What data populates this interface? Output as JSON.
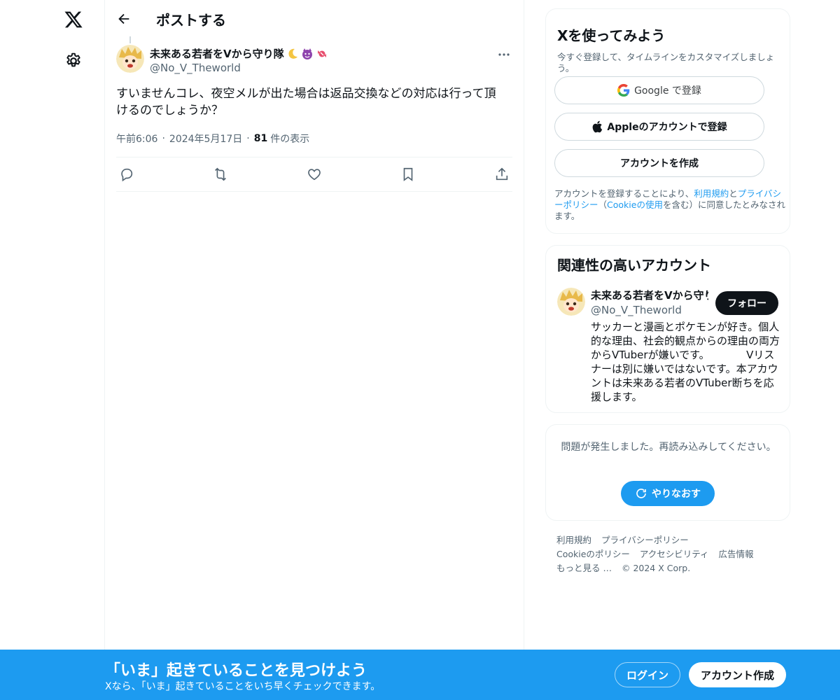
{
  "header": {
    "title": "ポストする"
  },
  "post": {
    "author_name": "未来ある若者をVから守り隊",
    "author_handle": "@No_V_Theworld",
    "text": "すいませんコレ、夜空メルが出た場合は返品交換などの対応は行って頂けるのでしょうか？",
    "time": "午前6:06",
    "date": "2024年5月17日",
    "views_count": "81",
    "views_label": "件の表示"
  },
  "signup_card": {
    "title": "Xを使ってみよう",
    "subtitle": "今すぐ登録して、タイムラインをカスタマイズしましょう。",
    "google_label": "Google で登録",
    "apple_label": "Appleのアカウントで登録",
    "create_label": "アカウントを作成",
    "legal_prefix": "アカウントを登録することにより、",
    "legal_terms": "利用規約",
    "legal_and": "と",
    "legal_privacy": "プライバシーポリシー",
    "legal_open": "（",
    "legal_cookie": "Cookieの使用",
    "legal_suffix": "を含む）に同意したとみなされます。"
  },
  "related_card": {
    "title": "関連性の高いアカウント",
    "name": "未来ある若者をVから守り隊",
    "handle": "@No_V_Theworld",
    "follow_label": "フォロー",
    "bio": "サッカーと漫画とポケモンが好き。個人的な理由、社会的観点からの理由の両方からVTuberが嫌いです。　　　　Vリスナーは別に嫌いではないです。本アカウントは未来ある若者のVTuber断ちを応援します。"
  },
  "error_card": {
    "message": "問題が発生しました。再読み込みしてください。",
    "retry_label": "やりなおす"
  },
  "footer": {
    "terms": "利用規約",
    "privacy": "プライバシーポリシー",
    "cookie": "Cookieのポリシー",
    "accessibility": "アクセシビリティ",
    "ads": "広告情報",
    "more": "もっと見る …",
    "copyright": "© 2024 X Corp."
  },
  "banner": {
    "title": "「いま」起きていることを見つけよう",
    "subtitle": "Xなら、「いま」起きていることをいち早くチェックできます。",
    "login_label": "ログイン",
    "signup_label": "アカウント作成"
  },
  "colors": {
    "accent": "#1d9bf0",
    "text": "#0f1419",
    "muted": "#536471"
  }
}
